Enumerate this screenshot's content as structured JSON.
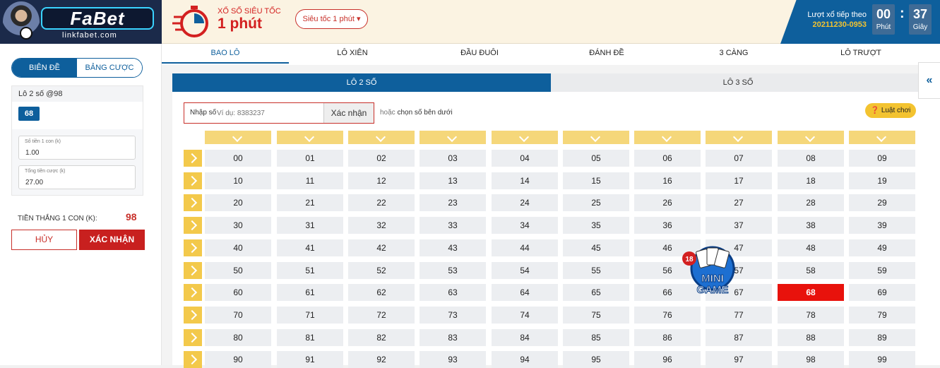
{
  "brand": {
    "name": "FaBet",
    "site": "linkfabet.com"
  },
  "header": {
    "game_subtitle": "XỔ SỐ SIÊU TỐC",
    "game_title": "1 phút",
    "speed_select": "Siêu tốc 1 phút",
    "next_draw_label": "Lượt xổ tiếp theo",
    "next_draw_code": "20211230-0953",
    "minutes": "00",
    "minutes_label": "Phút",
    "seconds": "37",
    "seconds_label": "Giây"
  },
  "left": {
    "tab_active": "BIÊN ĐỀ",
    "tab_inactive": "BẢNG CƯỢC",
    "bet_title": "Lô 2 số @98",
    "selected_number": "68",
    "amount_label": "Số tiền 1 con (k)",
    "amount_value": "1.00",
    "total_label": "Tổng tiền cược (k)",
    "total_value": "27.00",
    "win_label": "TIỀN THẮNG 1 CON (K):",
    "win_value": "98",
    "cancel_label": "HỦY",
    "confirm_label": "XÁC NHẬN"
  },
  "tabs": [
    "BAO LÔ",
    "LÔ XIÊN",
    "ĐẦU ĐUÔI",
    "ĐÁNH ĐỀ",
    "3 CÀNG",
    "LÔ TRƯỢT"
  ],
  "active_tab": 0,
  "subtabs": {
    "active": "LÔ 2 SỐ",
    "inactive": "LÔ 3 SỐ"
  },
  "entry": {
    "label": "Nhập số",
    "placeholder": "Ví dụ: 8383237",
    "button": "Xác nhận",
    "or_word": "hoặc",
    "or_rest": "chọn số bên dưới"
  },
  "rules_label": "Luật chơi",
  "grid": {
    "rows": [
      [
        "00",
        "01",
        "02",
        "03",
        "04",
        "05",
        "06",
        "07",
        "08",
        "09"
      ],
      [
        "10",
        "11",
        "12",
        "13",
        "14",
        "15",
        "16",
        "17",
        "18",
        "19"
      ],
      [
        "20",
        "21",
        "22",
        "23",
        "24",
        "25",
        "26",
        "27",
        "28",
        "29"
      ],
      [
        "30",
        "31",
        "32",
        "33",
        "34",
        "35",
        "36",
        "37",
        "38",
        "39"
      ],
      [
        "40",
        "41",
        "42",
        "43",
        "44",
        "45",
        "46",
        "47",
        "48",
        "49"
      ],
      [
        "50",
        "51",
        "52",
        "53",
        "54",
        "55",
        "56",
        "57",
        "58",
        "59"
      ],
      [
        "60",
        "61",
        "62",
        "63",
        "64",
        "65",
        "66",
        "67",
        "68",
        "69"
      ],
      [
        "70",
        "71",
        "72",
        "73",
        "74",
        "75",
        "76",
        "77",
        "78",
        "79"
      ],
      [
        "80",
        "81",
        "82",
        "83",
        "84",
        "85",
        "86",
        "87",
        "88",
        "89"
      ],
      [
        "90",
        "91",
        "92",
        "93",
        "94",
        "95",
        "96",
        "97",
        "98",
        "99"
      ]
    ],
    "selected": [
      "68"
    ]
  },
  "minigame": {
    "badge": "18",
    "label_top": "MINI",
    "label_bottom": "GAME"
  },
  "colors": {
    "primary": "#0e5f9c",
    "accent_red": "#c8302a",
    "gold": "#f3c330",
    "selected": "#e8120c"
  }
}
